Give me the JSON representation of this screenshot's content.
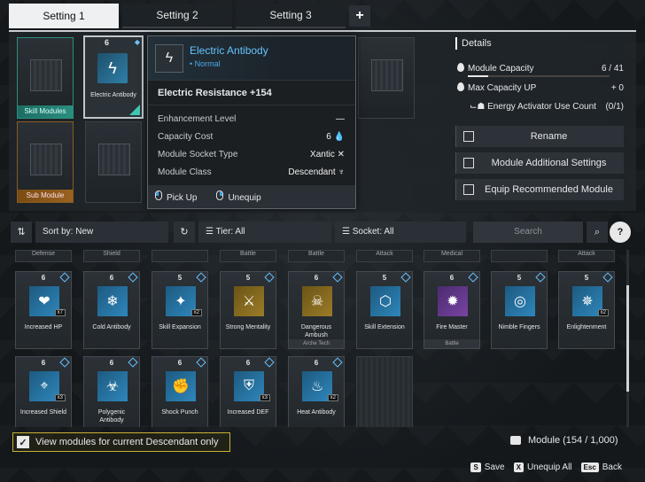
{
  "tabs": [
    {
      "label": "Setting 1",
      "active": true
    },
    {
      "label": "Setting 2",
      "active": false
    },
    {
      "label": "Setting 3",
      "active": false
    }
  ],
  "slots": {
    "skill_label": "Skill Modules",
    "sub_label": "Sub Module",
    "equipped_name": "Electric Antibody",
    "equipped_cost": "6"
  },
  "tooltip": {
    "name": "Electric Antibody",
    "rarity": "• Normal",
    "main_stat": "Electric Resistance +154",
    "rows": [
      {
        "label": "Enhancement Level",
        "value": "—"
      },
      {
        "label": "Capacity Cost",
        "value": "6"
      },
      {
        "label": "Module Socket Type",
        "value": "Xantic"
      },
      {
        "label": "Module Class",
        "value": "Descendant"
      }
    ],
    "pickup": "Pick Up",
    "unequip": "Unequip"
  },
  "details": {
    "title": "Details",
    "capacity_label": "Module Capacity",
    "capacity_value": "6 / 41",
    "capacity_fill": 0.146,
    "maxcap_label": "Max Capacity UP",
    "maxcap_value": "+ 0",
    "activator_label": "Energy Activator Use Count",
    "activator_value": "(0/1)",
    "btn_rename": "Rename",
    "btn_additional": "Module Additional Settings",
    "btn_recommended": "Equip Recommended Module"
  },
  "filters": {
    "sort": "Sort by: New",
    "tier": "Tier: All",
    "socket": "Socket: All",
    "search_placeholder": "Search",
    "help": "?"
  },
  "headers": [
    "Defense",
    "Shield",
    "",
    "Battle",
    "Battle",
    "Attack",
    "Medical",
    "",
    "Attack"
  ],
  "modules": [
    {
      "name": "Increased HP",
      "cost": "6",
      "count": "x7",
      "color": "i-blue",
      "glyph": "❤",
      "foot": ""
    },
    {
      "name": "Cold Antibody",
      "cost": "6",
      "count": "",
      "color": "i-blue",
      "glyph": "❄",
      "foot": ""
    },
    {
      "name": "Skill Expansion",
      "cost": "5",
      "count": "x2",
      "color": "i-blue",
      "glyph": "✦",
      "foot": ""
    },
    {
      "name": "Strong Mentality",
      "cost": "5",
      "count": "",
      "color": "i-gold",
      "glyph": "⚔",
      "foot": ""
    },
    {
      "name": "Dangerous Ambush",
      "cost": "6",
      "count": "",
      "color": "i-gold",
      "glyph": "☠",
      "foot": "Arche Tech"
    },
    {
      "name": "Skill Extension",
      "cost": "5",
      "count": "",
      "color": "i-blue",
      "glyph": "⬡",
      "foot": ""
    },
    {
      "name": "Fire Master",
      "cost": "6",
      "count": "",
      "color": "i-purple",
      "glyph": "✹",
      "foot": "Battle"
    },
    {
      "name": "Nimble Fingers",
      "cost": "5",
      "count": "",
      "color": "i-blue",
      "glyph": "◎",
      "foot": ""
    },
    {
      "name": "Enlightenment",
      "cost": "5",
      "count": "x2",
      "color": "i-blue",
      "glyph": "✵",
      "foot": ""
    },
    {
      "name": "Increased Shield",
      "cost": "6",
      "count": "x3",
      "color": "i-blue",
      "glyph": "⌖",
      "foot": ""
    },
    {
      "name": "Polygenic Antibody",
      "cost": "6",
      "count": "",
      "color": "i-blue",
      "glyph": "☣",
      "foot": ""
    },
    {
      "name": "Shock Punch",
      "cost": "6",
      "count": "",
      "color": "i-blue",
      "glyph": "✊",
      "foot": ""
    },
    {
      "name": "Increased DEF",
      "cost": "6",
      "count": "x3",
      "color": "i-blue",
      "glyph": "⛨",
      "foot": ""
    },
    {
      "name": "Heat Antibody",
      "cost": "6",
      "count": "x2",
      "color": "i-blue",
      "glyph": "♨",
      "foot": ""
    }
  ],
  "bottom": {
    "view_only": "View modules for current Descendant only",
    "module_count": "Module (154 / 1,000)",
    "save_key": "S",
    "save": "Save",
    "unequip_key": "X",
    "unequip_all": "Unequip All",
    "back_key": "Esc",
    "back": "Back"
  }
}
